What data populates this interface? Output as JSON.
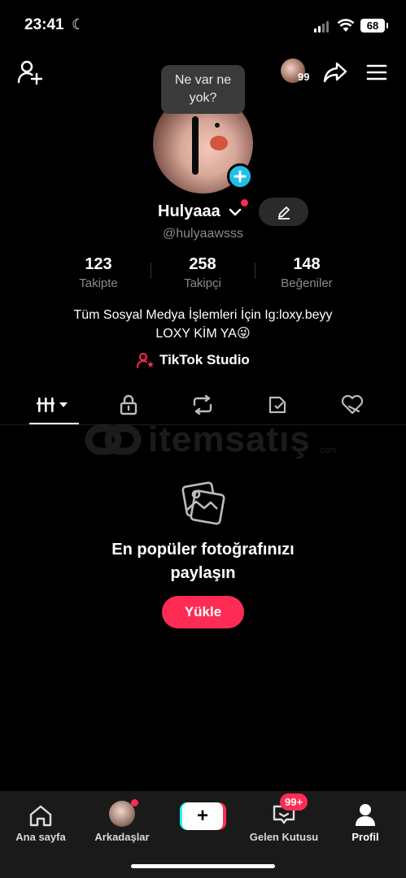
{
  "status_bar": {
    "time": "23:41",
    "battery": "68"
  },
  "header": {
    "notification_count": "99",
    "icons": [
      "add-user-icon",
      "share-icon",
      "menu-icon"
    ]
  },
  "profile": {
    "tooltip": "Ne var ne yok?",
    "name": "Hulyaaa",
    "handle": "@hulyaawsss",
    "stats": [
      {
        "value": "123",
        "label": "Takipte"
      },
      {
        "value": "258",
        "label": "Takipçi"
      },
      {
        "value": "148",
        "label": "Beğeniler"
      }
    ],
    "bio_line1": "Tüm Sosyal Medya İşlemleri İçin Ig:loxy.beyy",
    "bio_line2": "LOXY KİM YA😜",
    "studio_link": "TikTok Studio"
  },
  "tabs": [
    "videos-grid-icon",
    "lock-icon",
    "repost-icon",
    "tagged-icon",
    "liked-icon"
  ],
  "watermark": {
    "text": "itemsatış",
    "subtext": ".com"
  },
  "empty_state": {
    "title_line1": "En popüler fotoğrafınızı",
    "title_line2": "paylaşın",
    "button": "Yükle"
  },
  "bottom_nav": {
    "items": [
      {
        "label": "Ana sayfa",
        "icon": "home-icon"
      },
      {
        "label": "Arkadaşlar",
        "icon": "friends-avatar"
      },
      {
        "label": "",
        "icon": "create-icon"
      },
      {
        "label": "Gelen Kutusu",
        "icon": "inbox-icon"
      },
      {
        "label": "Profil",
        "icon": "profile-icon"
      }
    ],
    "inbox_badge": "99+"
  },
  "colors": {
    "accent": "#fe2c55",
    "cyan": "#25f4ee",
    "muted": "#8a8a8a"
  }
}
